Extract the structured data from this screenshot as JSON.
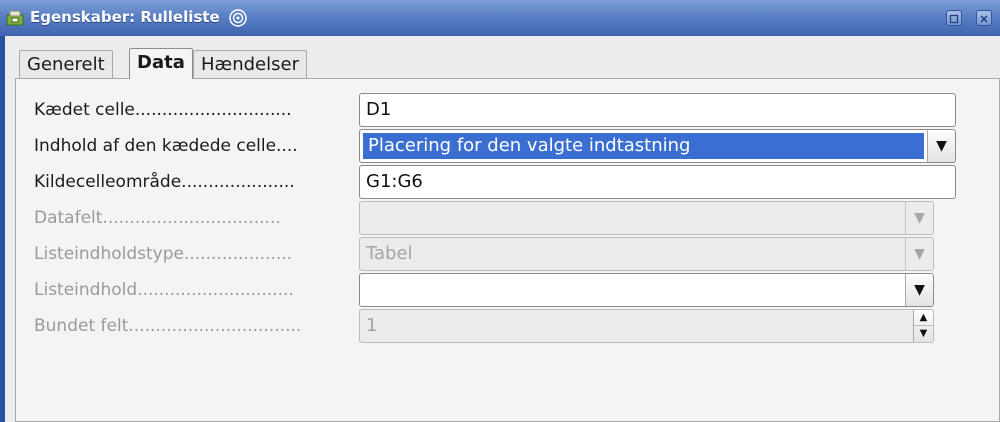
{
  "window": {
    "title": "Egenskaber: Rulleliste"
  },
  "tabs": [
    {
      "label": "Generelt"
    },
    {
      "label": "Data"
    },
    {
      "label": "Hændelser"
    }
  ],
  "form": {
    "rows": [
      {
        "label": "Kædet celle.............................",
        "value": "D1",
        "enabled": true,
        "control": "text"
      },
      {
        "label": "Indhold af den kædede celle....",
        "value": "Placering for den valgte indtastning",
        "enabled": true,
        "control": "dropdown"
      },
      {
        "label": "Kildecelleområde.....................",
        "value": "G1:G6",
        "enabled": true,
        "control": "text"
      },
      {
        "label": "Datafelt.................................",
        "value": "",
        "enabled": false,
        "control": "dropdown"
      },
      {
        "label": "Listeindholdstype....................",
        "value": "Tabel",
        "enabled": false,
        "control": "dropdown"
      },
      {
        "label": "Listeindhold.............................",
        "value": "",
        "enabled": true,
        "control": "dropdown"
      },
      {
        "label": "Bundet felt................................",
        "value": "1",
        "enabled": false,
        "control": "spinner"
      }
    ]
  },
  "icons": {
    "app": "app-icon",
    "swirl": "swirl-icon",
    "restore": "restore-icon",
    "close": "close-icon",
    "dropdown": "chevron-down-icon",
    "spin_up": "arrow-up-icon",
    "spin_down": "arrow-down-icon"
  },
  "colors": {
    "titlebar": "#5a7fc4",
    "selection": "#3a6fd1",
    "panel_bg": "#f4f4f4"
  }
}
